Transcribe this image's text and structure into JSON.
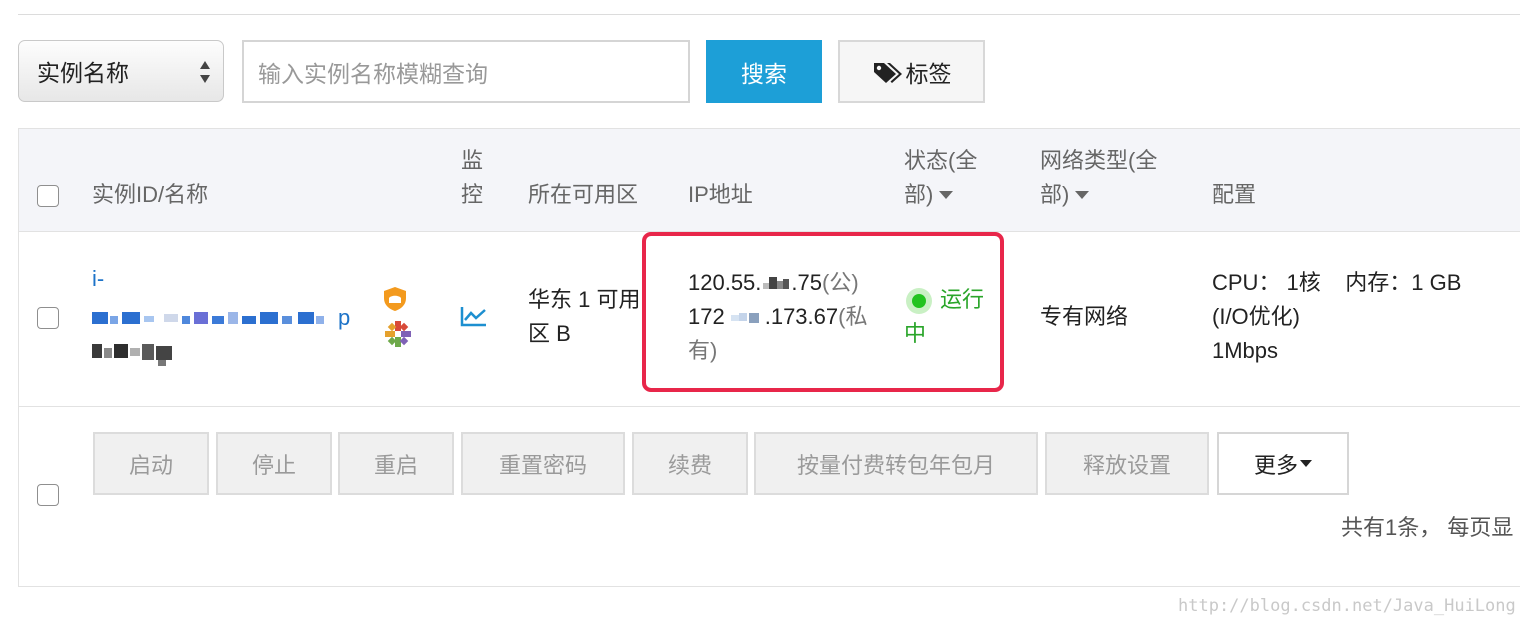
{
  "toolbar": {
    "select_value": "实例名称",
    "search_placeholder": "输入实例名称模糊查询",
    "search_label": "搜索",
    "tag_label": "标签"
  },
  "table": {
    "headers": {
      "instance": "实例ID/名称",
      "monitor_1": "监",
      "monitor_2": "控",
      "zone": "所在可用区",
      "ip": "IP地址",
      "status_1": "状态(全",
      "status_2": "部)",
      "network_1": "网络类型(全",
      "network_2": "部)",
      "config": "配置"
    },
    "row": {
      "id_prefix": "i-",
      "id_tail": "p",
      "zone_1": "华东 1 可用",
      "zone_2": "区 B",
      "public_ip_start": "120.55.",
      "public_ip_end": ".75",
      "public_suffix": "(公)",
      "private_ip_start": "172",
      "private_ip_end": ".173.67",
      "private_suffix_1": "(私",
      "private_suffix_2": "有)",
      "status_1": "运行",
      "status_2": "中",
      "network": "专有网络",
      "config_1": "CPU： 1核    内存：1 GB",
      "config_2": "(I/O优化)",
      "config_3": "1Mbps"
    }
  },
  "actions": {
    "start": "启动",
    "stop": "停止",
    "restart": "重启",
    "reset_password": "重置密码",
    "renew": "续费",
    "convert": "按量付费转包年包月",
    "release": "释放设置",
    "more": "更多"
  },
  "pager": {
    "summary": "共有1条， 每页显"
  },
  "watermark": "http://blog.csdn.net/Java_HuiLong",
  "colors": {
    "accent": "#1d9fd7",
    "link": "#1d73c8",
    "status_running": "#2aa52a",
    "highlight_box": "#e8264a"
  }
}
